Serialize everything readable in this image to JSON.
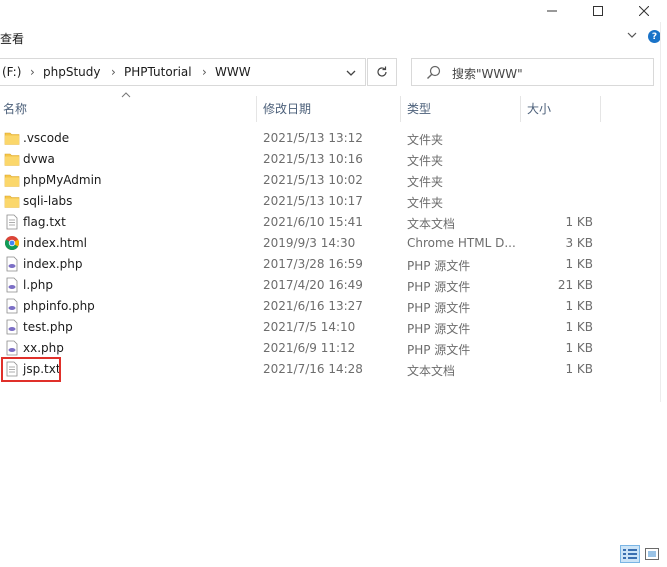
{
  "window": {
    "controls": {
      "minimize": "minimize",
      "maximize": "maximize",
      "close": "close"
    }
  },
  "ribbon": {
    "tab": "查看"
  },
  "address": {
    "drive": "(F:)",
    "crumbs": [
      "phpStudy",
      "PHPTutorial",
      "WWW"
    ]
  },
  "search": {
    "placeholder": "搜索\"WWW\""
  },
  "columns": {
    "name": "名称",
    "date": "修改日期",
    "type": "类型",
    "size": "大小"
  },
  "files": [
    {
      "name": ".vscode",
      "date": "2021/5/13 13:12",
      "type": "文件夹",
      "size": "",
      "icon": "folder-icon"
    },
    {
      "name": "dvwa",
      "date": "2021/5/13 10:16",
      "type": "文件夹",
      "size": "",
      "icon": "folder-icon"
    },
    {
      "name": "phpMyAdmin",
      "date": "2021/5/13 10:02",
      "type": "文件夹",
      "size": "",
      "icon": "folder-icon"
    },
    {
      "name": "sqli-labs",
      "date": "2021/5/13 10:17",
      "type": "文件夹",
      "size": "",
      "icon": "folder-icon"
    },
    {
      "name": "flag.txt",
      "date": "2021/6/10 15:41",
      "type": "文本文档",
      "size": "1 KB",
      "icon": "text-file-icon"
    },
    {
      "name": "index.html",
      "date": "2019/9/3 14:30",
      "type": "Chrome HTML D...",
      "size": "3 KB",
      "icon": "chrome-icon"
    },
    {
      "name": "index.php",
      "date": "2017/3/28 16:59",
      "type": "PHP 源文件",
      "size": "1 KB",
      "icon": "php-file-icon"
    },
    {
      "name": "l.php",
      "date": "2017/4/20 16:49",
      "type": "PHP 源文件",
      "size": "21 KB",
      "icon": "php-file-icon"
    },
    {
      "name": "phpinfo.php",
      "date": "2021/6/16 13:27",
      "type": "PHP 源文件",
      "size": "1 KB",
      "icon": "php-file-icon"
    },
    {
      "name": "test.php",
      "date": "2021/7/5 14:10",
      "type": "PHP 源文件",
      "size": "1 KB",
      "icon": "php-file-icon"
    },
    {
      "name": "xx.php",
      "date": "2021/6/9 11:12",
      "type": "PHP 源文件",
      "size": "1 KB",
      "icon": "php-file-icon"
    },
    {
      "name": "jsp.txt",
      "date": "2021/7/16 14:28",
      "type": "文本文档",
      "size": "1 KB",
      "icon": "text-file-icon"
    }
  ],
  "colors": {
    "highlight": "#e0302a",
    "folder": "#f5c64a",
    "php": "#7c6fc6"
  }
}
